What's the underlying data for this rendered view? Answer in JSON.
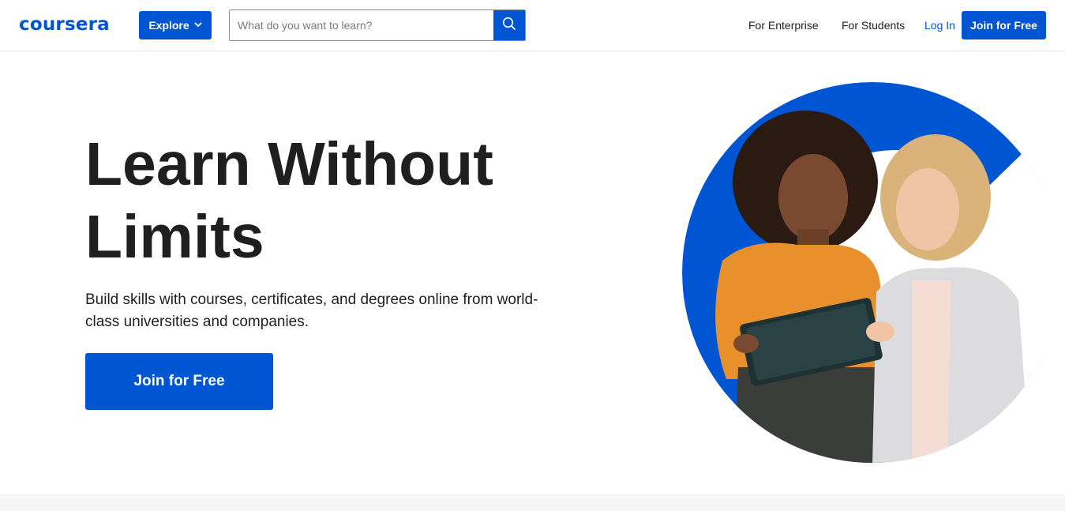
{
  "header": {
    "logo_text": "coursera",
    "explore_label": "Explore",
    "search": {
      "placeholder": "What do you want to learn?",
      "value": ""
    },
    "nav": {
      "enterprise": "For Enterprise",
      "students": "For Students",
      "login": "Log In",
      "join": "Join for Free"
    }
  },
  "hero": {
    "title_line1": "Learn Without",
    "title_line2": "Limits",
    "subtitle": "Build skills with courses, certificates, and degrees online from world-class universities and companies.",
    "cta": "Join for Free"
  },
  "icons": {
    "explore_chevron": "chevron-down-icon",
    "search": "search-icon"
  },
  "colors": {
    "brand_blue": "#0056d2",
    "text": "#1f1f1f",
    "footer_band": "#f5f5f5"
  }
}
